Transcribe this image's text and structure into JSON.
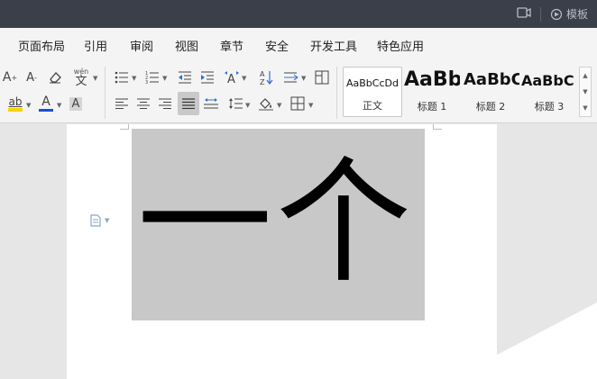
{
  "titlebar": {
    "template_label": "模板"
  },
  "menu": {
    "items": [
      "页面布局",
      "引用",
      "审阅",
      "视图",
      "章节",
      "安全",
      "开发工具",
      "特色应用"
    ]
  },
  "ribbon": {
    "font_group": {
      "increase_font": "A",
      "decrease_font": "A",
      "phonetic_label": "wén",
      "phonetic_char": "文",
      "highlight_label": "ab",
      "font_color_label": "A",
      "char_shading_label": "A"
    },
    "colors": {
      "highlight": "#f5d50a",
      "font_color": "#1a4fd6"
    }
  },
  "styles_gallery": {
    "items": [
      {
        "sample": "AaBbCcDd",
        "label": "正文",
        "selected": true
      },
      {
        "sample": "AaBb",
        "label": "标题 1",
        "selected": false
      },
      {
        "sample": "AaBbC",
        "label": "标题 2",
        "selected": false
      },
      {
        "sample": "AaBbC",
        "label": "标题 3",
        "selected": false
      }
    ]
  },
  "document": {
    "content_text": "一个"
  }
}
